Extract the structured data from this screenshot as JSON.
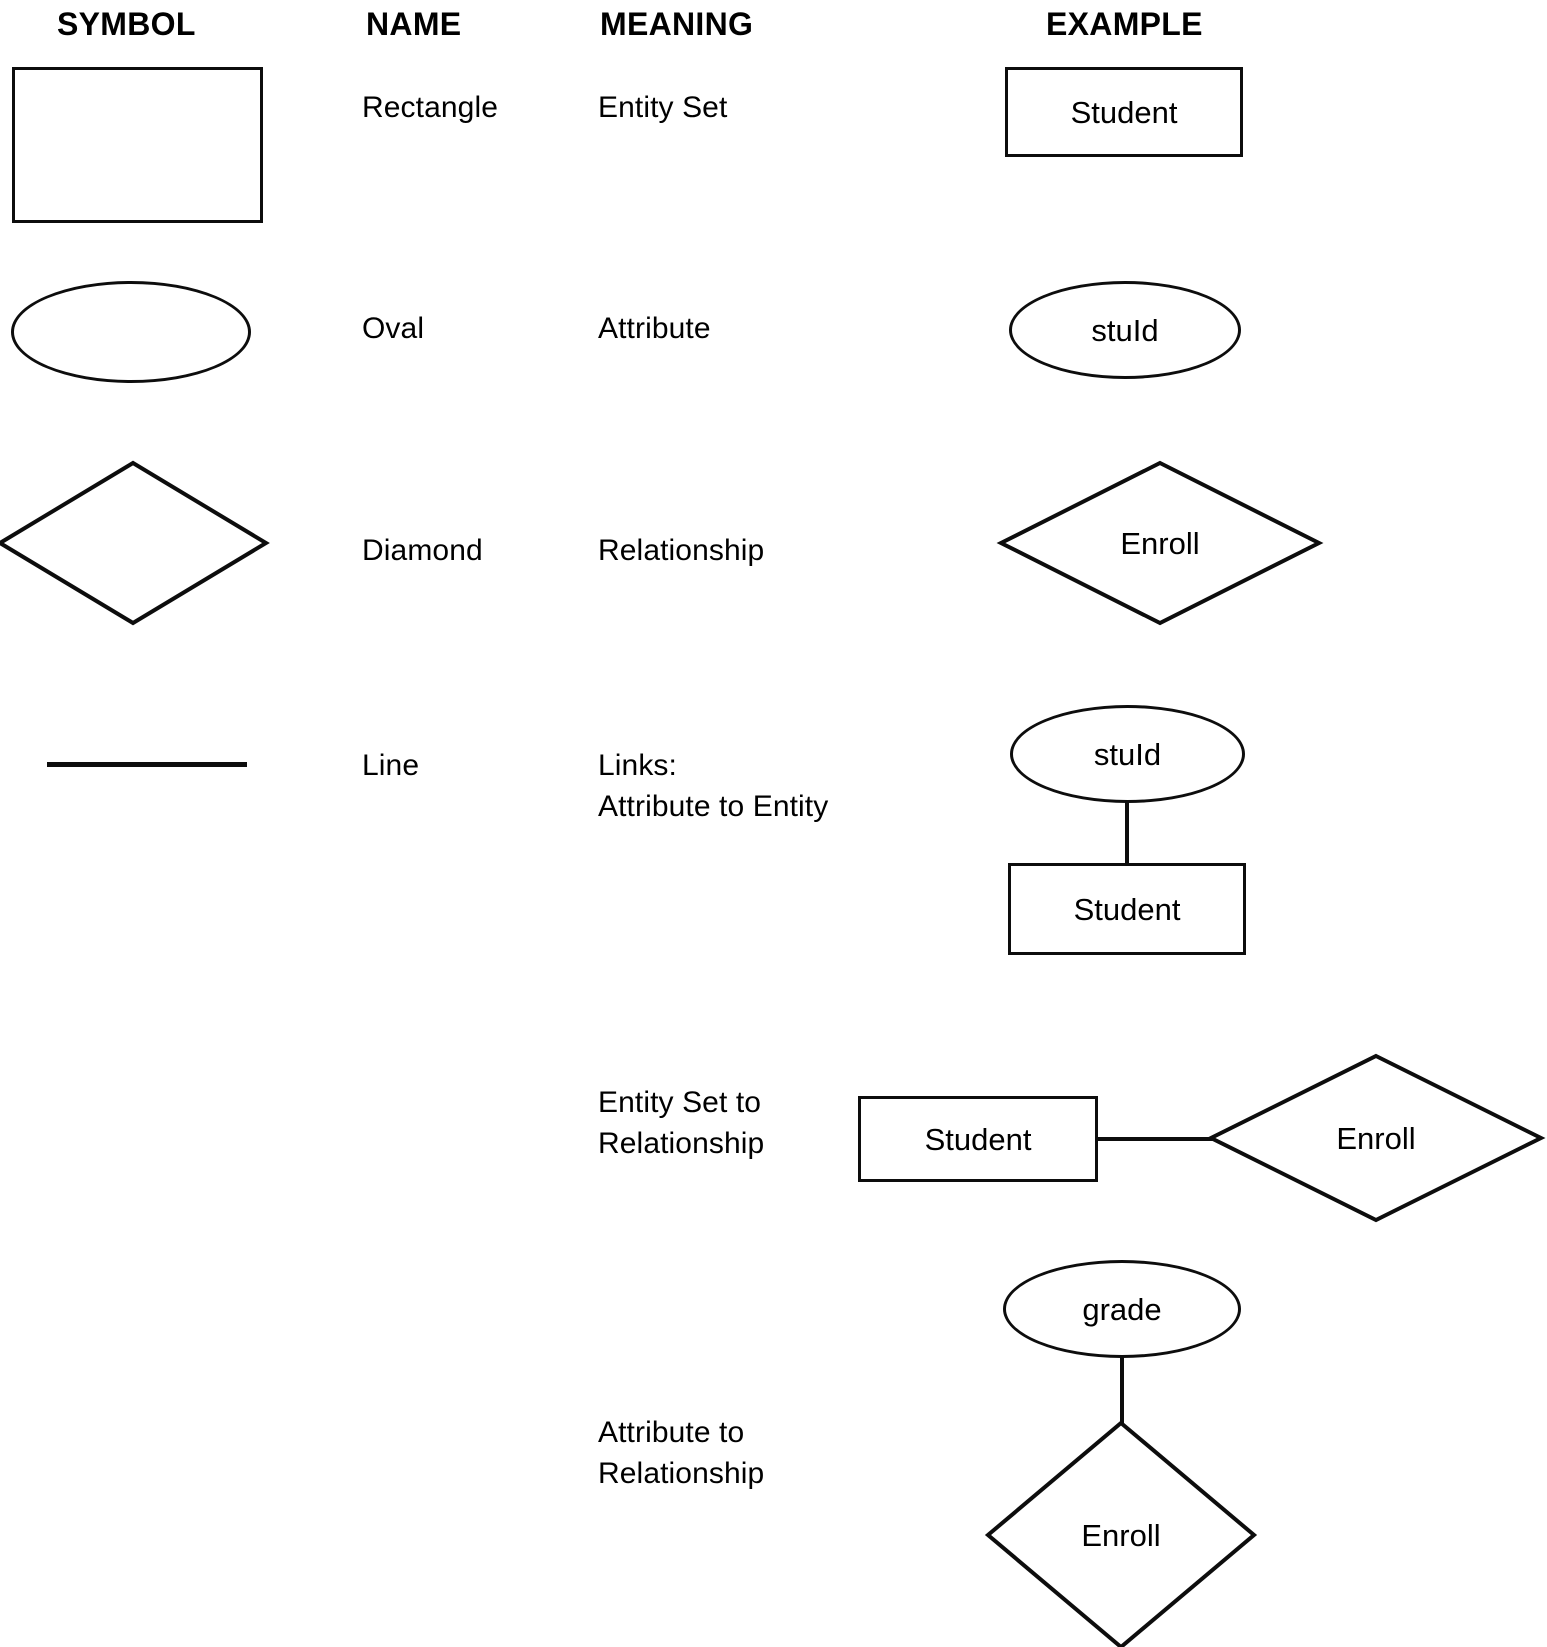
{
  "headers": {
    "symbol": "SYMBOL",
    "name": "NAME",
    "meaning": "MEANING",
    "example": "EXAMPLE"
  },
  "rows": [
    {
      "symbol_kind": "rectangle",
      "name": "Rectangle",
      "meaning": "Entity Set",
      "example_labels": {
        "entity": "Student"
      }
    },
    {
      "symbol_kind": "oval",
      "name": "Oval",
      "meaning": "Attribute",
      "example_labels": {
        "attribute": "stuId"
      }
    },
    {
      "symbol_kind": "diamond",
      "name": "Diamond",
      "meaning": "Relationship",
      "example_labels": {
        "relationship": "Enroll"
      }
    },
    {
      "symbol_kind": "line",
      "name": "Line",
      "meaning": "Links:\nAttribute to Entity",
      "example_labels": {
        "attribute": "stuId",
        "entity": "Student"
      }
    },
    {
      "symbol_kind": "none",
      "name": "",
      "meaning": "Entity Set to\nRelationship",
      "example_labels": {
        "entity": "Student",
        "relationship": "Enroll"
      }
    },
    {
      "symbol_kind": "none",
      "name": "",
      "meaning": "Attribute to\nRelationship",
      "example_labels": {
        "attribute": "grade",
        "relationship": "Enroll"
      }
    }
  ],
  "colors": {
    "stroke": "#0d0d0d",
    "background": "#ffffff",
    "text": "#000000"
  }
}
